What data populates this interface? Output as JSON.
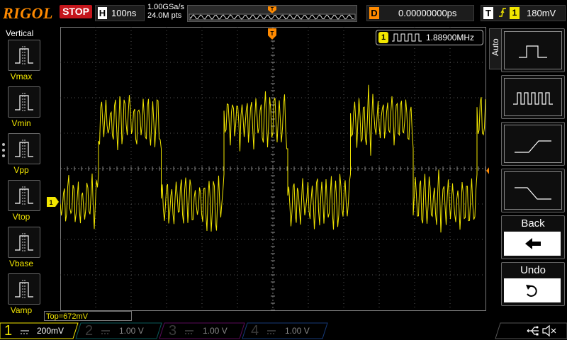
{
  "brand": "RIGOL",
  "run_state": "STOP",
  "horizontal": {
    "letter": "H",
    "timebase": "100ns",
    "sample_rate": "1.00GSa/s",
    "memory_depth": "24.0M pts"
  },
  "delay": {
    "letter": "D",
    "value": "0.00000000ps"
  },
  "trigger": {
    "letter": "T",
    "edge": "rising",
    "source": "1",
    "level": "180mV"
  },
  "frequency_readout": {
    "channel": "1",
    "value": "1.88900MHz"
  },
  "left_panel": {
    "title": "Vertical",
    "items": [
      {
        "label": "Vmax"
      },
      {
        "label": "Vmin"
      },
      {
        "label": "Vpp"
      },
      {
        "label": "Vtop"
      },
      {
        "label": "Vbase"
      },
      {
        "label": "Vamp"
      }
    ]
  },
  "right_panel": {
    "auto_tab": "Auto",
    "back_label": "Back",
    "undo_label": "Undo"
  },
  "measurement_bar": {
    "text": "Top=672mV"
  },
  "channels": [
    {
      "num": "1",
      "scale": "200mV",
      "color": "#f2e600",
      "active": true
    },
    {
      "num": "2",
      "scale": "1.00 V",
      "color": "#00b0b0",
      "active": false
    },
    {
      "num": "3",
      "scale": "1.00 V",
      "color": "#d000d0",
      "active": false
    },
    {
      "num": "4",
      "scale": "1.00 V",
      "color": "#2a6cff",
      "active": false
    }
  ],
  "colors": {
    "trace": "#f2e600",
    "accent": "#ff8a00",
    "stop": "#c4161c"
  },
  "icons": [
    "usb-icon",
    "speaker-mute-icon"
  ]
}
